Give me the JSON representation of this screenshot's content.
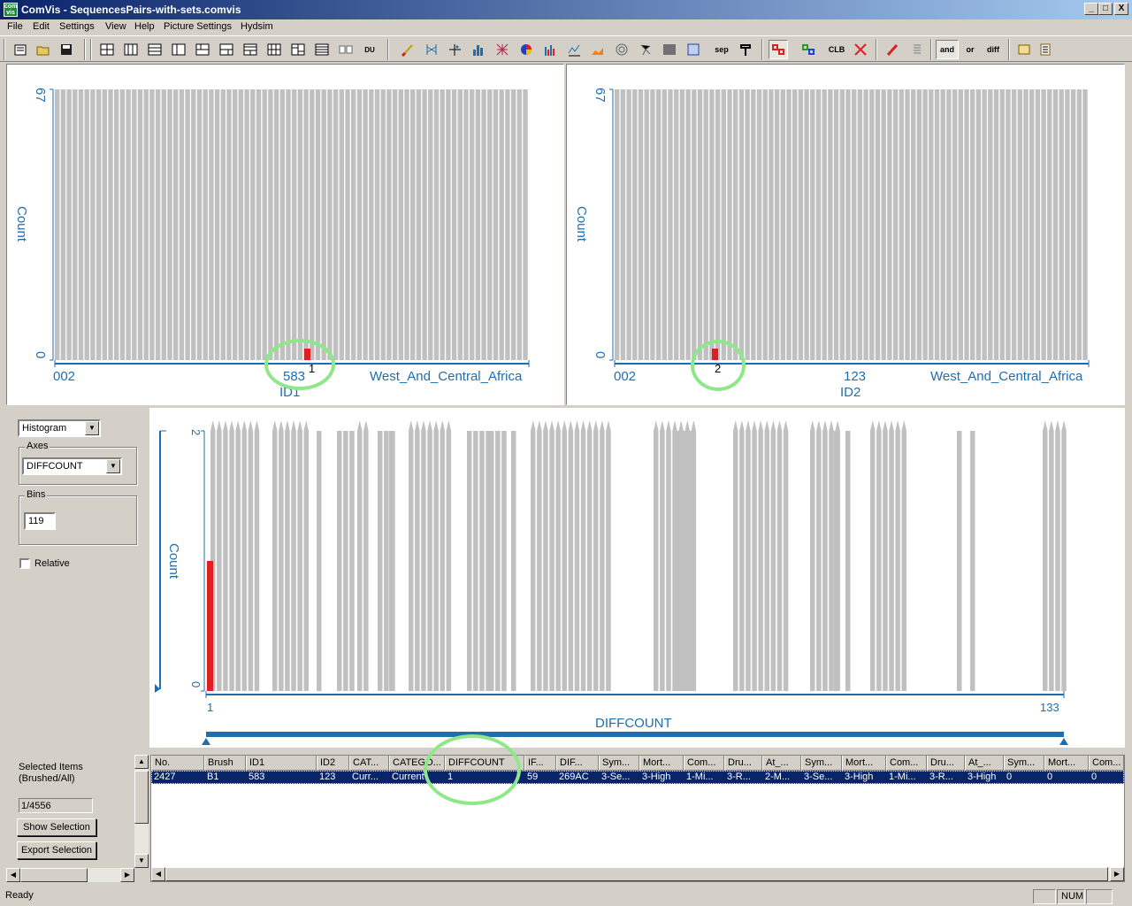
{
  "window": {
    "title": "ComVis - SequencesPairs-with-sets.comvis",
    "app_icon_text": "com vis",
    "controls": [
      "_",
      "□",
      "X"
    ]
  },
  "menu": [
    "File",
    "Edit",
    "Settings",
    "View",
    "Help",
    "Picture Settings",
    "Hydsim"
  ],
  "toolbar": {
    "sep_label": "sep",
    "clb_label": "CLB",
    "and_label": "and",
    "or_label": "or",
    "diff_label": "diff",
    "du_label": "DU"
  },
  "panel1": {
    "y_max": "67",
    "y_min": "0",
    "y_label": "Count",
    "x_ticks": [
      "002",
      "583",
      "West_And_Central_Africa"
    ],
    "x_label": "ID1",
    "selected_label": "1",
    "bar_color": "#c0c0c0",
    "selected_color": "#e02020"
  },
  "panel2": {
    "y_max": "67",
    "y_min": "0",
    "y_label": "Count",
    "x_ticks": [
      "002",
      "123",
      "West_And_Central_Africa"
    ],
    "x_label": "ID2",
    "selected_label": "2"
  },
  "controls": {
    "view_type": "Histogram",
    "axes_title": "Axes",
    "axes_value": "DIFFCOUNT",
    "bins_title": "Bins",
    "bins_value": "119",
    "relative_label": "Relative",
    "relative_checked": false
  },
  "panel3": {
    "y_max": "2",
    "y_min": "0",
    "y_label": "Count",
    "x_min_label": "1",
    "x_max_label": "133",
    "x_label": "DIFFCOUNT"
  },
  "selection": {
    "title": "Selected Items (Brushed/All)",
    "count": "1/4556",
    "show_button": "Show Selection",
    "export_button": "Export Selection"
  },
  "table": {
    "headers": [
      "No.",
      "Brush",
      "ID1",
      "ID2",
      "CAT...",
      "CATEGO...",
      "DIFFCOUNT",
      "IF...",
      "DIF...",
      "Sym...",
      "Mort...",
      "Com...",
      "Dru...",
      "At_...",
      "Sym...",
      "Mort...",
      "Com...",
      "Dru...",
      "At_...",
      "Sym...",
      "Mort...",
      "Com..."
    ],
    "rows": [
      [
        "2427",
        "B1",
        "583",
        "123",
        "Curr...",
        "Current",
        "1",
        "59",
        "269AC",
        "3-Se...",
        "3-High",
        "1-Mi...",
        "3-R...",
        "2-M...",
        "3-Se...",
        "3-High",
        "1-Mi...",
        "3-R...",
        "3-High",
        "0",
        "0",
        "0"
      ]
    ]
  },
  "status": {
    "text": "Ready",
    "num": "NUM"
  }
}
